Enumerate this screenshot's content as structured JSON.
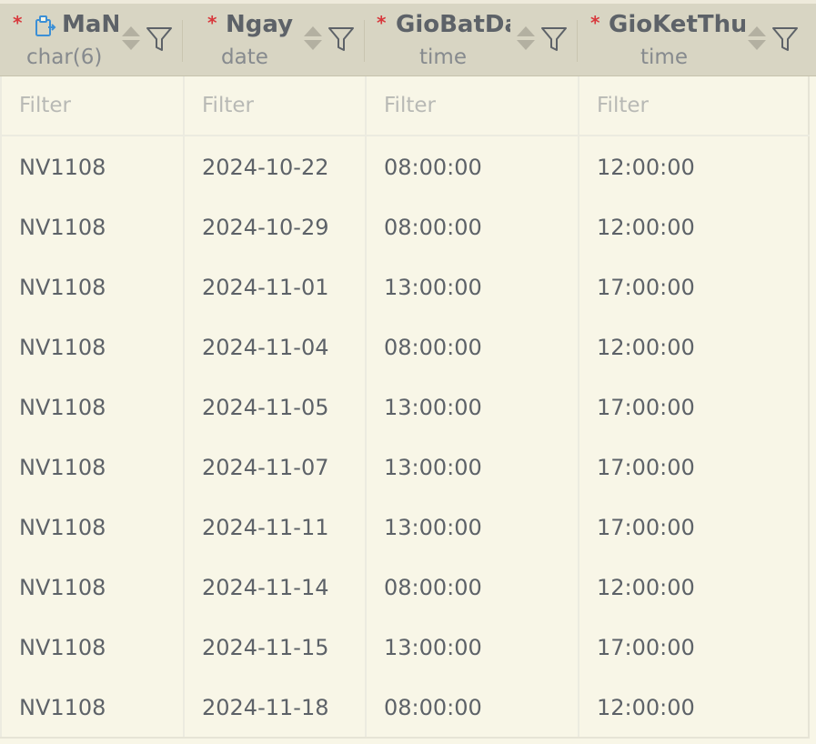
{
  "columns": [
    {
      "name": "MaN",
      "type": "char(6)",
      "required": true,
      "key_icon": "foreign-key-icon"
    },
    {
      "name": "Ngay",
      "type": "date",
      "required": true
    },
    {
      "name": "GioBatDau",
      "type": "time",
      "required": true
    },
    {
      "name": "GioKetThuc",
      "type": "time",
      "required": true
    }
  ],
  "required_marker": "*",
  "filter_placeholder": "Filter",
  "rows": [
    [
      "NV1108",
      "2024-10-22",
      "08:00:00",
      "12:00:00"
    ],
    [
      "NV1108",
      "2024-10-29",
      "08:00:00",
      "12:00:00"
    ],
    [
      "NV1108",
      "2024-11-01",
      "13:00:00",
      "17:00:00"
    ],
    [
      "NV1108",
      "2024-11-04",
      "08:00:00",
      "12:00:00"
    ],
    [
      "NV1108",
      "2024-11-05",
      "13:00:00",
      "17:00:00"
    ],
    [
      "NV1108",
      "2024-11-07",
      "13:00:00",
      "17:00:00"
    ],
    [
      "NV1108",
      "2024-11-11",
      "13:00:00",
      "17:00:00"
    ],
    [
      "NV1108",
      "2024-11-14",
      "08:00:00",
      "12:00:00"
    ],
    [
      "NV1108",
      "2024-11-15",
      "13:00:00",
      "17:00:00"
    ],
    [
      "NV1108",
      "2024-11-18",
      "08:00:00",
      "12:00:00"
    ]
  ],
  "icons": {
    "sort": "sort-icon",
    "filter": "filter-icon"
  },
  "colors": {
    "header_bg": "#d8d5c3",
    "grid_bg": "#f8f6e7",
    "required": "#d8383c",
    "key_icon": "#3b8fd6",
    "text": "#5d6268"
  }
}
